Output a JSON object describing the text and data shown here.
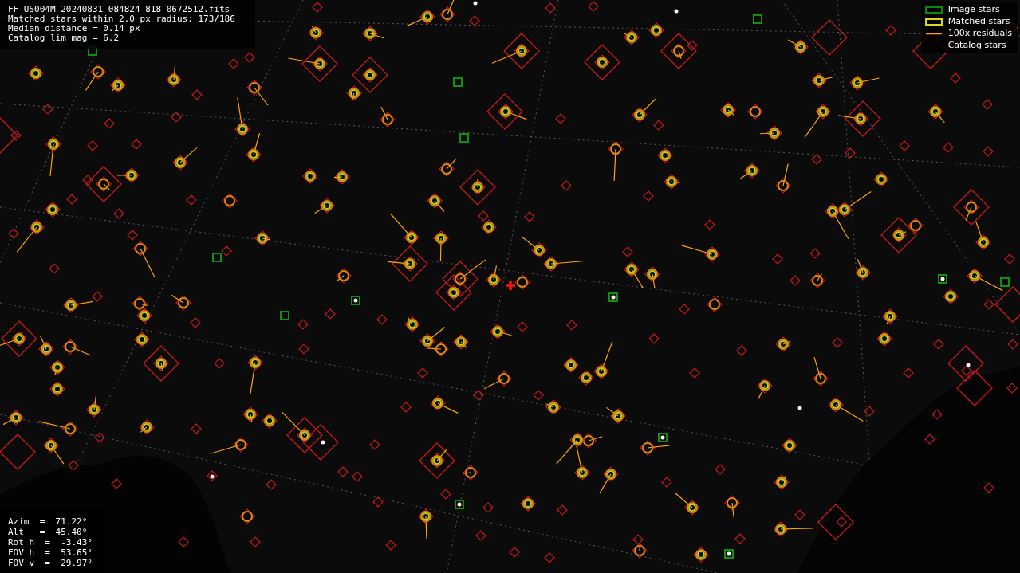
{
  "header": {
    "lines": [
      "FF_US004M_20240831_084824_818_0672512.fits",
      "Matched stars within 2.0 px radius: 173/186",
      "Median distance = 0.14 px",
      "Catalog lim mag = 6.2"
    ]
  },
  "legend": [
    {
      "label": "Image stars",
      "kind": "image"
    },
    {
      "label": "Matched stars",
      "kind": "matched"
    },
    {
      "label": "100x residuals",
      "kind": "residual"
    },
    {
      "label": "Catalog stars",
      "kind": "catalog"
    }
  ],
  "pointing": {
    "lines": [
      "Azim  =  71.22°",
      "Alt   =  45.40°",
      "Rot h  =  -3.43°",
      "FOV h  =  53.65°",
      "FOV v  =  29.97°"
    ]
  }
}
